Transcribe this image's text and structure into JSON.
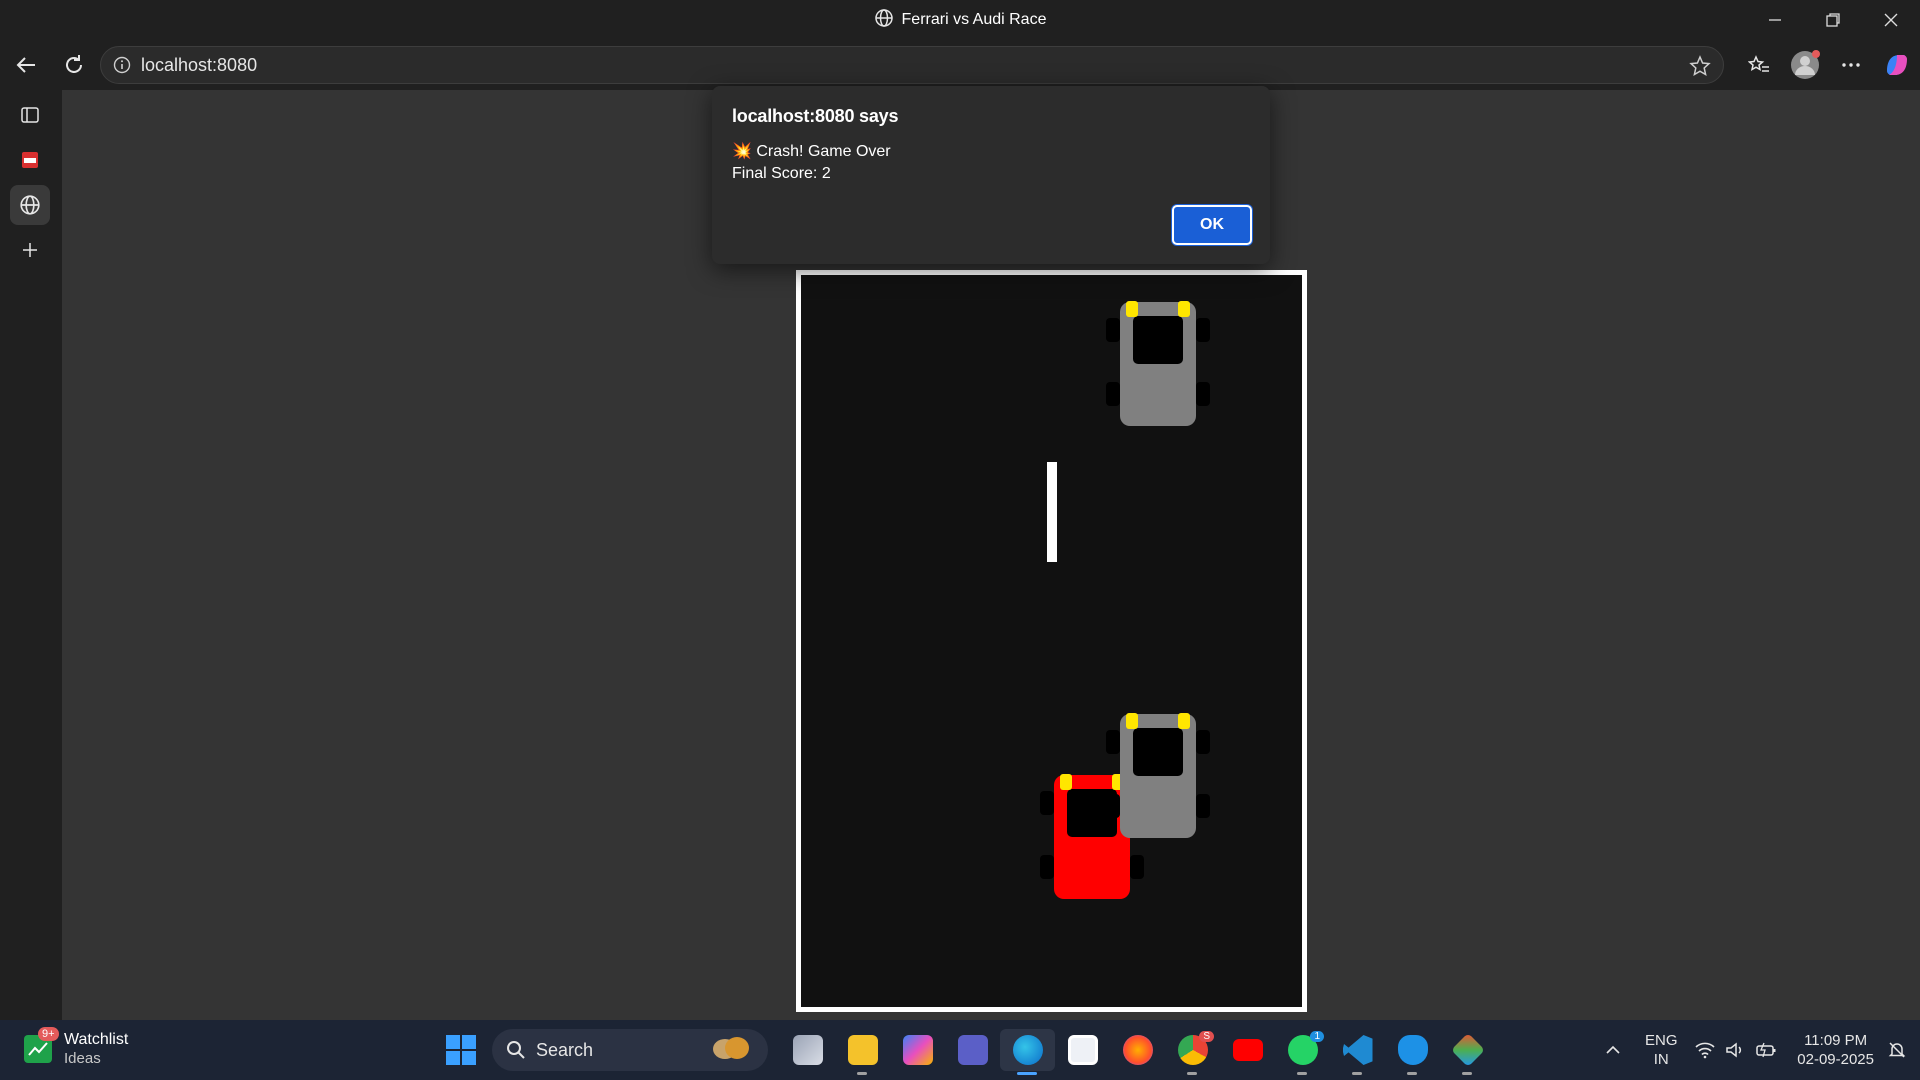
{
  "window": {
    "title": "Ferrari vs Audi Race"
  },
  "browser": {
    "url": "localhost:8080"
  },
  "dialog": {
    "title": "localhost:8080 says",
    "line1": "💥 Crash! Game Over",
    "line2": "Final Score: 2",
    "ok_label": "OK"
  },
  "game": {
    "player_color": "#ff0000",
    "enemy_color": "#808080",
    "headlight_color": "#ffe600"
  },
  "taskbar": {
    "widget_title": "Watchlist",
    "widget_subtitle": "Ideas",
    "widget_badge": "9+",
    "search_placeholder": "Search",
    "chrome_badge": "S",
    "whatsapp_badge": "1",
    "lang_top": "ENG",
    "lang_bottom": "IN",
    "time": "11:09 PM",
    "date": "02-09-2025"
  }
}
